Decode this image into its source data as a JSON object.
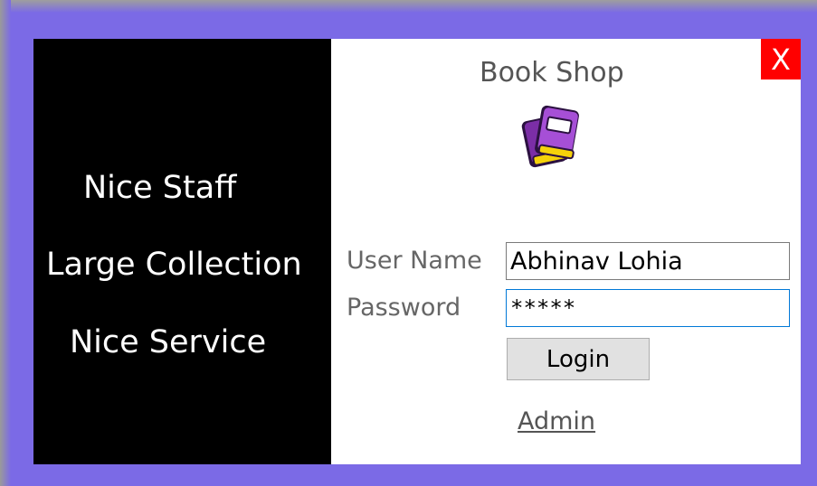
{
  "window": {
    "title": "Book Shop",
    "close_label": "X"
  },
  "features": [
    "Nice Staff",
    "Large Collection",
    "Nice Service"
  ],
  "form": {
    "username_label": "User Name",
    "username_value": "Abhinav Lohia",
    "password_label": "Password",
    "password_value": "*****",
    "login_label": "Login",
    "admin_label": "Admin"
  },
  "icons": {
    "book": "book-icon"
  },
  "colors": {
    "background": "#7b6ae6",
    "left_panel": "#000000",
    "close_button": "#ff0000",
    "book_purple": "#7b2ea6",
    "book_yellow": "#f5d20a"
  }
}
